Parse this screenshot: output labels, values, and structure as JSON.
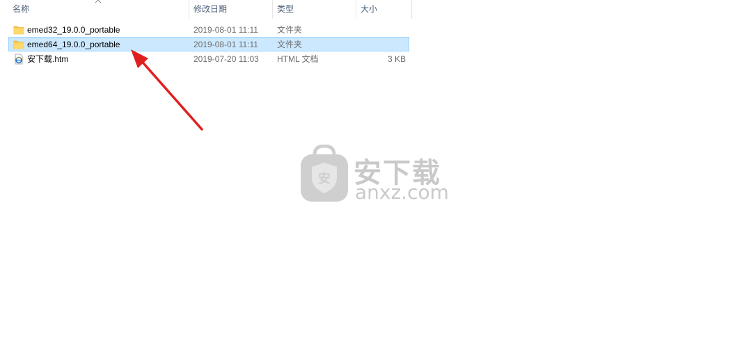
{
  "columns": {
    "name": "名称",
    "date": "修改日期",
    "type": "类型",
    "size": "大小"
  },
  "files": [
    {
      "name": "emed32_19.0.0_portable",
      "date": "2019-08-01  11:11",
      "type": "文件夹",
      "size": "",
      "icon": "folder-icon",
      "selected": false
    },
    {
      "name": "emed64_19.0.0_portable",
      "date": "2019-08-01  11:11",
      "type": "文件夹",
      "size": "",
      "icon": "folder-icon",
      "selected": true
    },
    {
      "name": "安下载.htm",
      "date": "2019-07-20  11:03",
      "type": "HTML 文档",
      "size": "3 KB",
      "icon": "html-file-icon",
      "selected": false
    }
  ],
  "watermark": {
    "cn": "安下载",
    "en": "anxz.com",
    "badge": "安"
  },
  "colors": {
    "selection_bg": "#cce8ff",
    "selection_border": "#99d1ff",
    "arrow": "#e02020",
    "folder": "#f4c443",
    "watermark": "#c9c9c9"
  }
}
